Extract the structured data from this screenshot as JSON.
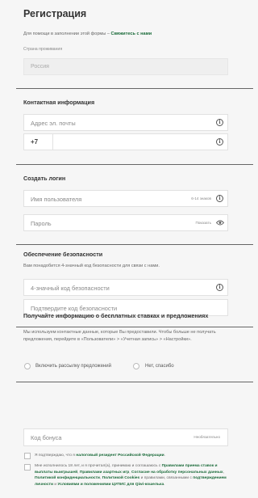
{
  "header": {
    "title": "Регистрация",
    "help_text": "Для помощи в заполнении этой формы –",
    "help_link": "Свяжитесь с нами"
  },
  "country": {
    "label": "Страна проживания",
    "value": "Россия"
  },
  "contact": {
    "title": "Контактная информация",
    "email_placeholder": "Адрес эл. почты",
    "phone_prefix": "+7"
  },
  "login": {
    "title": "Создать логин",
    "username_placeholder": "Имя пользователя",
    "username_hint": "6-14 знаков",
    "password_placeholder": "Пароль",
    "password_hint": "Показать"
  },
  "security": {
    "title": "Обеспечение безопасности",
    "note": "Вам понадобится 4-значный код безопасности для связи с нами.",
    "code_placeholder": "4-значный код безопасности",
    "confirm_placeholder": "Подтвердите код безопасности"
  },
  "offers": {
    "title": "Получайте информацию о бесплатных ставках и предложениях",
    "text": "Мы используем контактные данные, которые Вы предоставили. Чтобы больше не получать предложения, перейдите в «Пользователи» > «Учетная запись» > «Настройки».",
    "option_yes": "Включить рассылку предложений",
    "option_no": "Нет, спасибо"
  },
  "bonus": {
    "placeholder": "Код бонуса",
    "hint": "Необязательно"
  },
  "tax": {
    "text_before": "Я подтверждаю, что я",
    "link": "налоговый резидент Российской Федерации",
    "text_after": "."
  },
  "terms": {
    "t1": "Мне исполнилось 18 лет, и я прочитал(а), принимаю и соглашаюсь с",
    "l1": "Правилами приема ставок и выплаты выигрышей",
    "t2": ",",
    "l2": "Правилами азартных игр",
    "t3": ",",
    "l3": "Согласие на обработку персональных данных",
    "t4": ",",
    "l4": "Политикой конфиденциальности",
    "t5": ",",
    "l5": "Политикой Cookies",
    "t6": "и правилами, связанными с",
    "l6": "подтверждением личности",
    "t7": "и",
    "l7": "Условиями и положениями ЦУПИС для Qiwi-кошелька",
    "t8": "."
  }
}
